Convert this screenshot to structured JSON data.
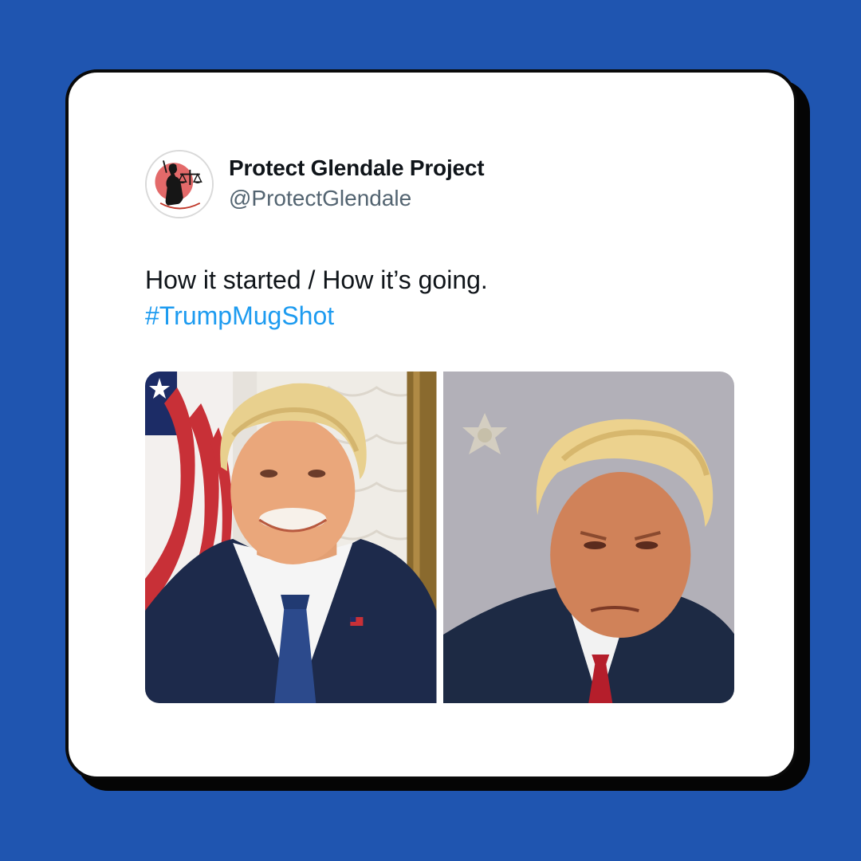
{
  "tweet": {
    "display_name": "Protect Glendale Project",
    "handle": "@ProtectGlendale",
    "text": "How it started / How it’s going.",
    "hashtag": "#TrumpMugShot",
    "avatar_icon": "lady-justice-logo-icon",
    "media": [
      {
        "name": "official-portrait-photo",
        "description_icon": "portrait-photo"
      },
      {
        "name": "mugshot-photo",
        "description_icon": "mugshot-photo"
      }
    ]
  },
  "colors": {
    "background": "#1f55b0",
    "card": "#ffffff",
    "hashtag": "#1d9bf0",
    "handle": "#536471",
    "text": "#0f1419"
  }
}
